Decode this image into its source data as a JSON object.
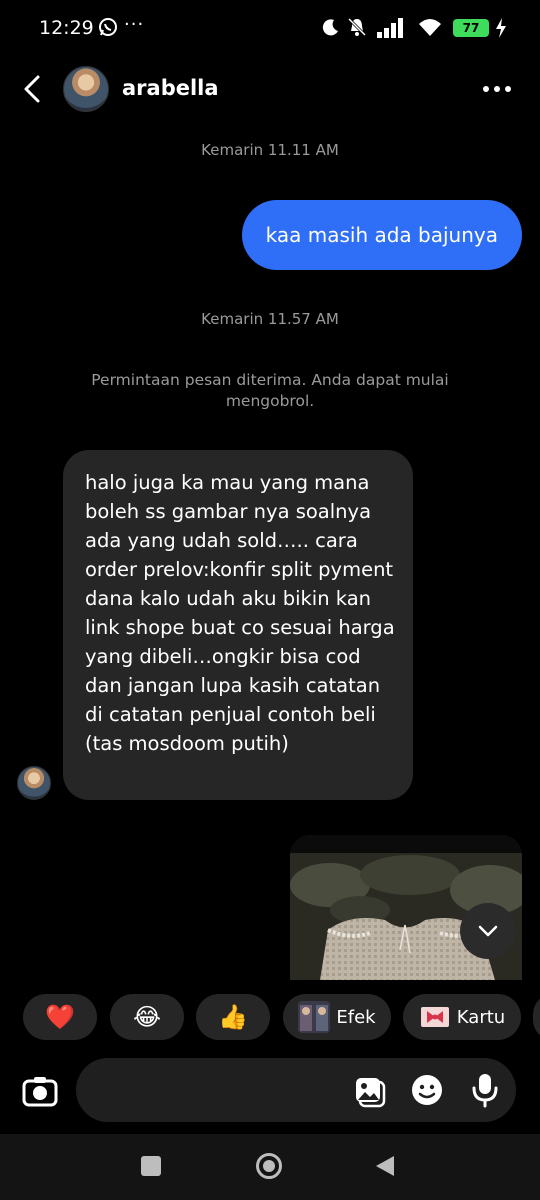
{
  "status_bar": {
    "time": "12:29",
    "dots": "···",
    "battery": "77"
  },
  "header": {
    "name": "arabella"
  },
  "messages": {
    "timestamp_1": "Kemarin 11.11 AM",
    "outgoing_1": "kaa masih ada bajunya",
    "timestamp_2": "Kemarin 11.57 AM",
    "system_note": "Permintaan pesan diterima. Anda dapat mulai mengobrol.",
    "incoming_1": "halo juga ka mau yang mana boleh ss gambar nya soalnya ada yang udah sold….. cara order prelov:konfir split pyment dana kalo udah aku bikin kan link shope buat co sesuai harga yang dibeli…ongkir bisa cod dan jangan lupa kasih catatan di catatan penjual contoh beli (tas mosdoom putih)"
  },
  "reactions": {
    "heart": "❤️",
    "laugh": "😂",
    "thumbs": "👍",
    "effects_label": "Efek",
    "card_label": "Kartu"
  },
  "composer": {
    "placeholder": ""
  },
  "colors": {
    "outgoing_bubble": "#2f6ef6",
    "incoming_bubble": "#262626",
    "background": "#000000",
    "battery": "#3ddc5a"
  },
  "icons": [
    "back-icon",
    "more-icon",
    "camera-icon",
    "gallery-icon",
    "sticker-icon",
    "mic-icon",
    "chevron-down-icon"
  ]
}
